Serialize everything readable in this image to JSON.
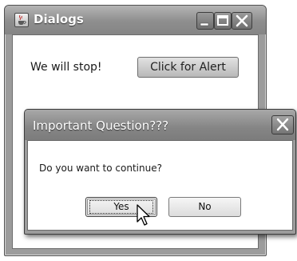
{
  "main_window": {
    "title": "Dialogs",
    "status_text": "We will stop!",
    "alert_button_label": "Click for Alert"
  },
  "dialog": {
    "title": "Important Question???",
    "message": "Do you want to continue?",
    "yes_label": "Yes",
    "no_label": "No"
  },
  "icons": {
    "app": "java-cup-icon",
    "minimize": "minimize-icon",
    "maximize": "maximize-icon",
    "close": "close-icon",
    "cursor": "mouse-pointer-icon"
  },
  "colors": {
    "titlebar": "#8e8e8e",
    "title_text": "#ffffff",
    "client_bg": "#ffffff",
    "button_face": "#d0d0d0"
  }
}
